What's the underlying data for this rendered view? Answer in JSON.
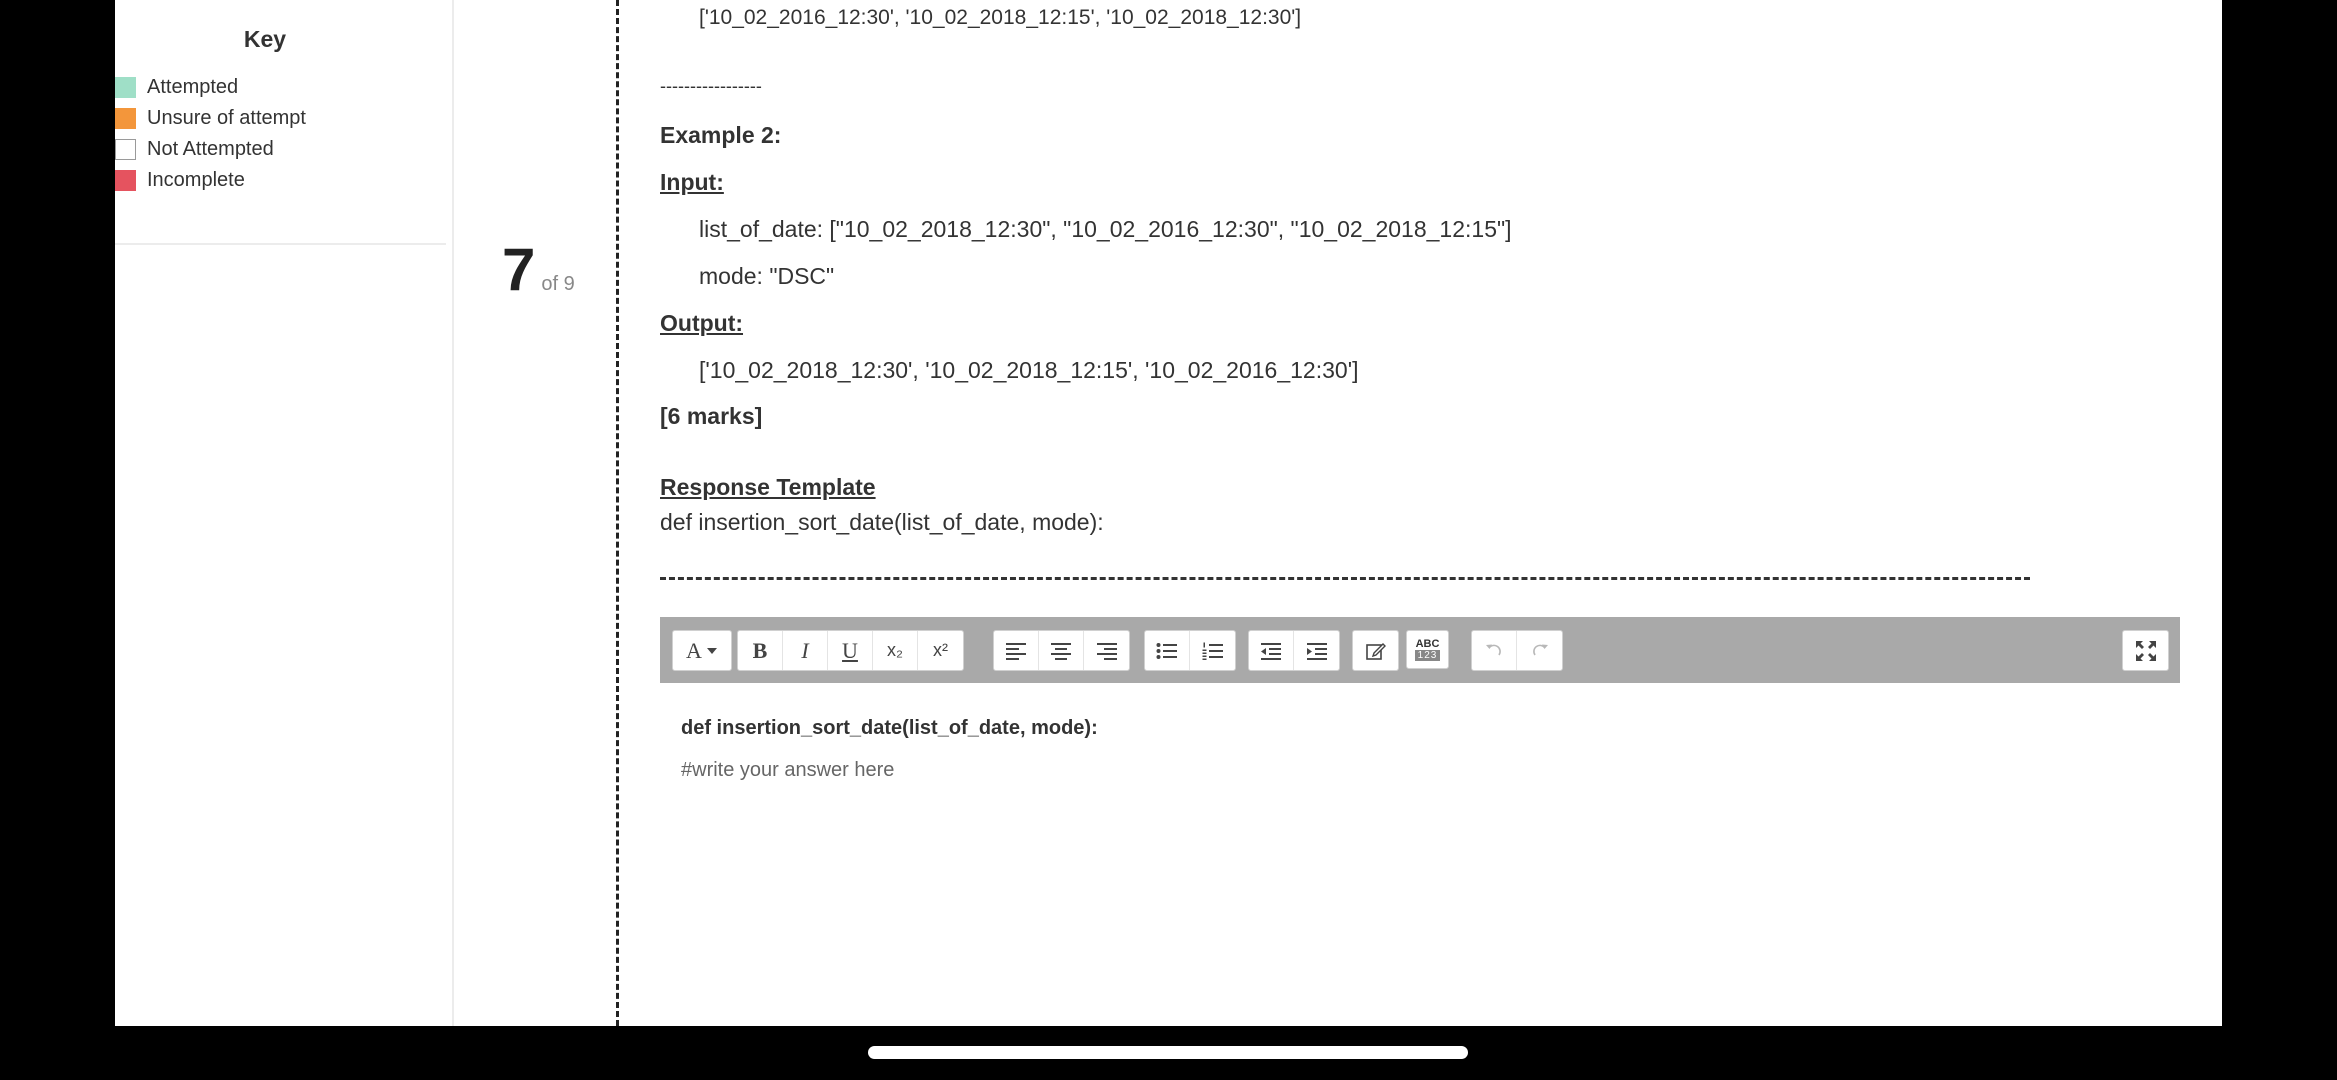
{
  "sidebar": {
    "key_title": "Key",
    "key_items": [
      {
        "label": "Attempted",
        "color": "#9fdfc7"
      },
      {
        "label": "Unsure of attempt",
        "color": "#f3963b"
      },
      {
        "label": "Not Attempted",
        "color": "#ffffff"
      },
      {
        "label": "Incomplete",
        "color": "#e5535f"
      }
    ]
  },
  "question": {
    "number": "7",
    "of_total": "of 9",
    "example1_output": "['10_02_2016_12:30', '10_02_2018_12:15', '10_02_2018_12:30']",
    "separator": "-----------------",
    "example2_heading": "Example 2:",
    "input_label": "Input:",
    "input_list": "list_of_date: [\"10_02_2018_12:30\", \"10_02_2016_12:30\", \"10_02_2018_12:15\"]",
    "input_mode": "mode: \"DSC\"",
    "output_label": "Output:",
    "output_value": "['10_02_2018_12:30', '10_02_2018_12:15', '10_02_2016_12:30']",
    "marks": "[6 marks]",
    "template_heading": "Response Template",
    "template_code": "def insertion_sort_date(list_of_date, mode):"
  },
  "editor": {
    "toolbar": {
      "font_label": "A",
      "bold": "B",
      "italic": "I",
      "underline": "U",
      "subscript": "x₂",
      "superscript": "x²",
      "spellcheck_top": "ABC",
      "spellcheck_bottom": "123"
    },
    "content_line1": "def insertion_sort_date(list_of_date, mode):",
    "content_line2": "#write your answer here"
  },
  "colors": {
    "toolbar_bg": "#a9a9a9",
    "float_button_bg": "#6b6b6b",
    "float_button_icon": "#f0a182"
  },
  "icons": [
    "caret-down-icon",
    "align-left-icon",
    "align-center-icon",
    "align-right-icon",
    "bullet-list-icon",
    "numbered-list-icon",
    "outdent-icon",
    "indent-icon",
    "edit-icon",
    "spellcheck-icon",
    "undo-icon",
    "redo-icon",
    "fullscreen-icon",
    "code-icon"
  ]
}
